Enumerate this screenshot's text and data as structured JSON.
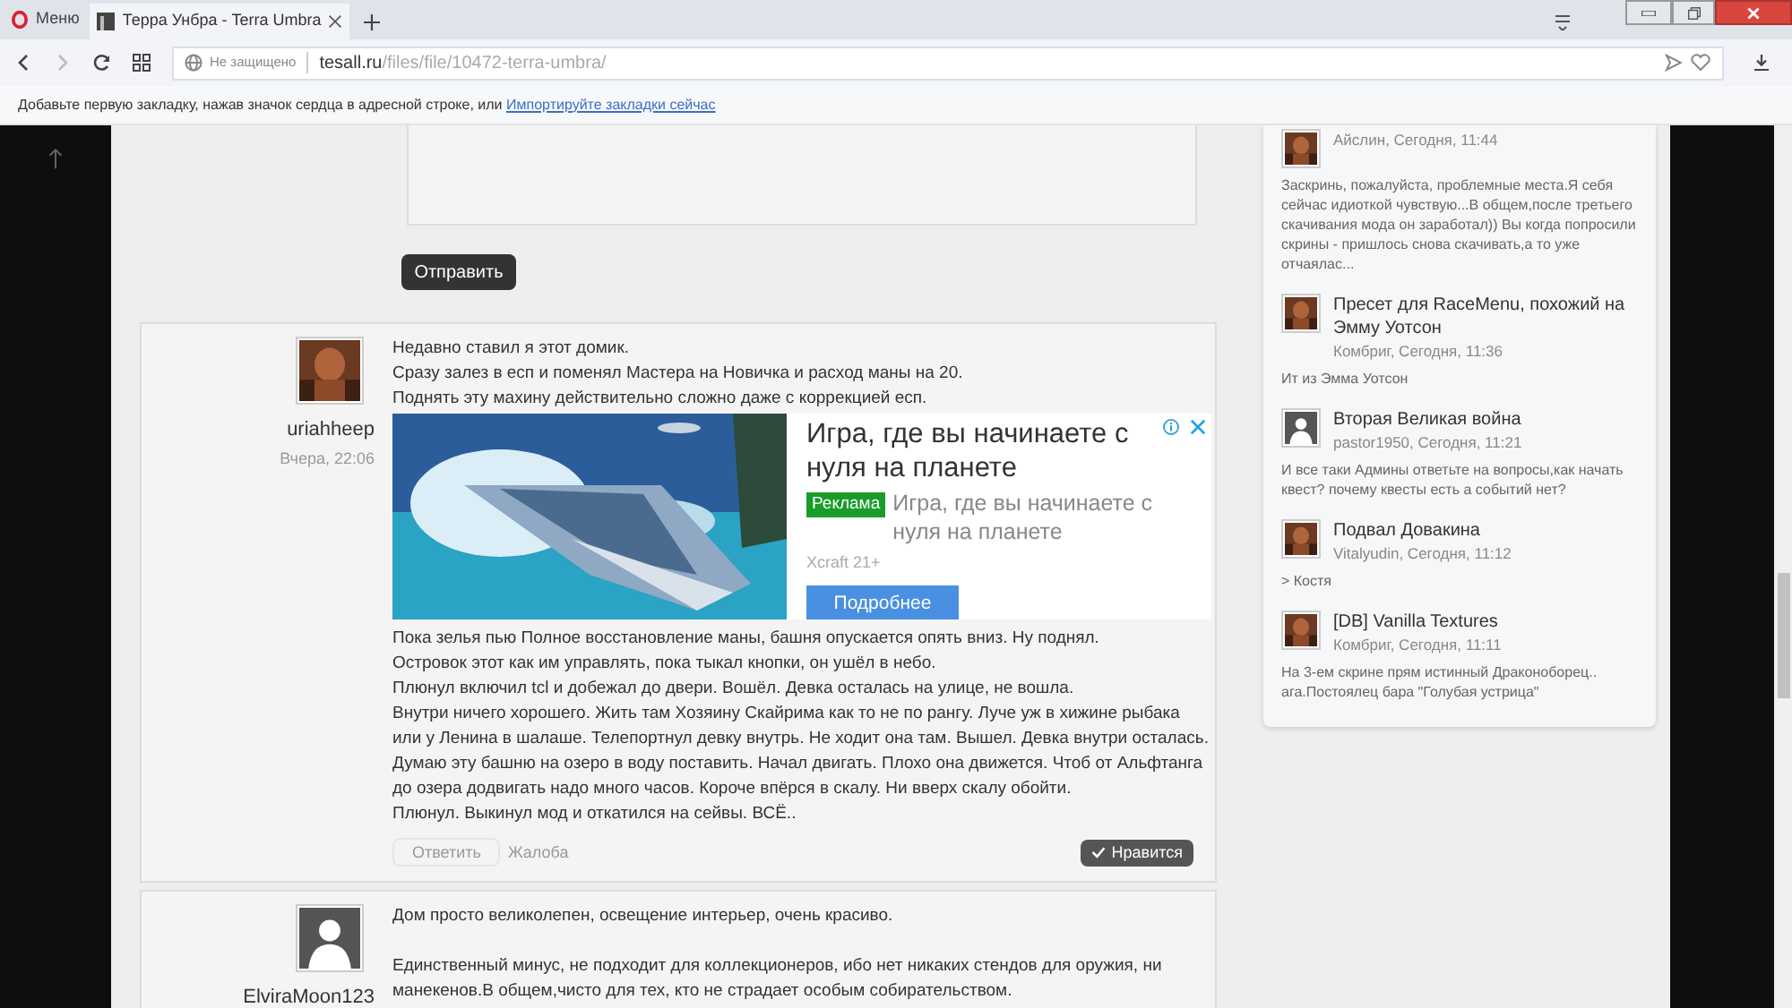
{
  "browser": {
    "menu_label": "Меню",
    "tabs": [
      {
        "title": "Терра Унбра - Terra Umbra",
        "selected": true
      }
    ],
    "address": {
      "security": "Не защищено",
      "domain": "tesall.ru",
      "path": "/files/file/10472-terra-umbra/"
    },
    "bookmark_hint": {
      "text": "Добавьте первую закладку, нажав значок сердца в адресной строке, или",
      "link": "Импортируйте закладки сейчас"
    }
  },
  "comment_form": {
    "submit": "Отправить"
  },
  "posts": [
    {
      "author": "uriahheep",
      "date": "Вчера, 22:06",
      "avatar": {
        "kind": "picture"
      },
      "paragraphs_before": [
        [
          "Недавно ставил я этот домик.",
          "Сразу залез в есп и поменял Мастера на Новичка и расход маны на 20.",
          "Поднять эту махину действительно сложно даже с коррекцией есп."
        ]
      ],
      "ad": {
        "headline": "Игра, где вы начинаете с нуля на планете",
        "badge": "Реклама",
        "description": "Игра, где вы начинаете с нуля на планете",
        "source": "Xcraft 21+",
        "button": "Подробнее"
      },
      "lines_after": [
        "Пока зелья пью Полное восстановление маны, башня опускается опять вниз. Ну поднял.",
        "Островок этот как им управлять, пока тыкал кнопки, он ушёл в небо.",
        "Плюнул включил tcl и добежал до двери. Вошёл. Девка осталась на улице, не вошла.",
        "Внутри ничего хорошего. Жить там Хозяину Скайрима как то не по рангу. Луче уж в хижине рыбака",
        "или у Ленина в шалаше. Телепортнул девку внутрь. Не ходит она там. Вышел. Девка внутри осталась.",
        "Думаю эту башню на озеро в воду поставить. Начал двигать. Плохо она движется. Чтоб от Альфтанга",
        "до озера додвигать надо много часов. Короче впёрся в скалу. Ни вверх скалу обойти.",
        "Плюнул. Выкинул мод и откатился на сейвы. ВСЁ.."
      ],
      "actions": [
        "Ответить",
        "Жалоба"
      ],
      "like": "Нравится"
    },
    {
      "author": "ElviraMoon123",
      "avatar": {
        "kind": "silhouette"
      },
      "paragraphs_before": [
        [
          "Дом просто великолепен, освещение интерьер, очень красиво."
        ],
        [
          "Единственный минус, не подходит для коллекционеров, ибо нет никаких стендов для оружия, ни",
          "манекенов.В общем,чисто для тех, кто не страдает особым собирательством."
        ]
      ]
    }
  ],
  "sidebar": {
    "items": [
      {
        "avatar": {
          "kind": "picture"
        },
        "meta": "Айслин, Сегодня, 11:44",
        "excerpt": "Заскринь, пожалуйста, проблемные места.Я себя сейчас идиоткой чувствую...В общем,после третьего скачивания мода он заработал)) Вы когда попросили скрины - пришлось снова скачивать,а то уже отчаялас..."
      },
      {
        "avatar": {
          "kind": "picture"
        },
        "title": "Пресет для RaceMenu, похожий на Эмму Уотсон",
        "meta": "Комбриг, Сегодня, 11:36",
        "excerpt": "Ит из Эмма Уотсон"
      },
      {
        "avatar": {
          "kind": "silhouette"
        },
        "title": "Вторая Великая война",
        "meta": "pastor1950, Сегодня, 11:21",
        "excerpt": "И все таки Админы ответьте на вопросы,как начать квест? почему квесты есть а событий нет?"
      },
      {
        "avatar": {
          "kind": "picture"
        },
        "title": "Подвал Довакина",
        "meta": "Vitalyudin, Сегодня, 11:12",
        "excerpt": "> Костя"
      },
      {
        "avatar": {
          "kind": "picture"
        },
        "title": "[DB] Vanilla Textures",
        "meta": "Комбриг, Сегодня, 11:11",
        "excerpt": "На 3-ем скрине прям истинный Драконоборец.. ага.Постоялец бара \"Голубая устрица\""
      }
    ]
  }
}
